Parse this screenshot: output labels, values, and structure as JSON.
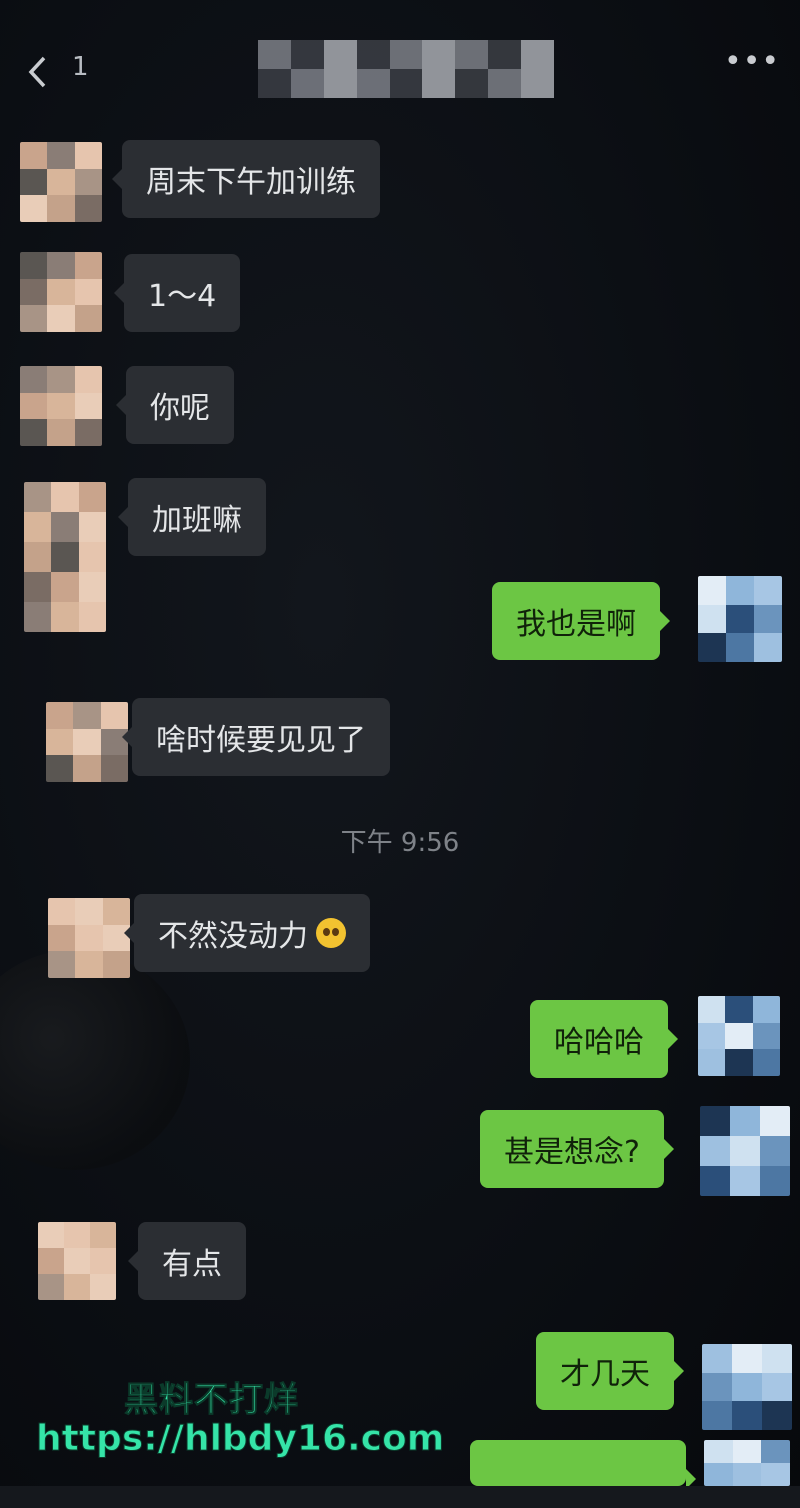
{
  "header": {
    "unread_count": "1",
    "title": "",
    "back_icon": "chevron-left-icon",
    "more_icon": "more-dots-icon"
  },
  "messages": [
    {
      "side": "in",
      "text": "周末下午加训练"
    },
    {
      "side": "in",
      "text": "1～4"
    },
    {
      "side": "in",
      "text": "你呢"
    },
    {
      "side": "in",
      "text": "加班嘛"
    },
    {
      "side": "out",
      "text": "我也是啊"
    },
    {
      "side": "in",
      "text": "啥时候要见见了"
    },
    {
      "side": "in",
      "text": "不然没动力",
      "emoji": "pleading-face-icon"
    },
    {
      "side": "out",
      "text": "哈哈哈"
    },
    {
      "side": "out",
      "text": "甚是想念?"
    },
    {
      "side": "in",
      "text": "有点"
    },
    {
      "side": "out",
      "text": "才几天"
    }
  ],
  "timestamp": "下午 9:56",
  "watermark": {
    "line1": "黑料不打烊",
    "line2": "https://hlbdy16.com"
  },
  "colors": {
    "background": "#0c0f14",
    "incoming_bubble": "#2b2e33",
    "outgoing_bubble": "#6cc644",
    "watermark": "#35e4a8"
  }
}
